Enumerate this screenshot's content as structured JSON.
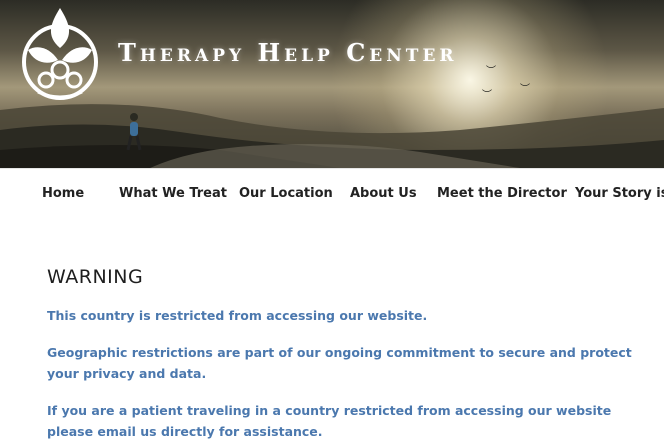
{
  "header": {
    "brand_title": "Therapy Help Center",
    "logo_icon": "lotus-emblem-icon"
  },
  "nav": {
    "items": [
      {
        "label": "Home"
      },
      {
        "label": "What We Treat"
      },
      {
        "label": "Our Location"
      },
      {
        "label": "About Us"
      },
      {
        "label": "Meet the Director"
      },
      {
        "label": "Your Story is H"
      }
    ]
  },
  "main": {
    "heading": "WARNING",
    "paragraphs": [
      "This country is restricted from accessing our website.",
      "Geographic restrictions are part of our ongoing commitment to secure and protect your privacy and data.",
      "If you are a patient traveling in a country restricted from accessing our website please email us directly for assistance."
    ]
  },
  "colors": {
    "message_text": "#4b78ae",
    "heading_text": "#1e1e1e",
    "nav_text": "#222222"
  }
}
